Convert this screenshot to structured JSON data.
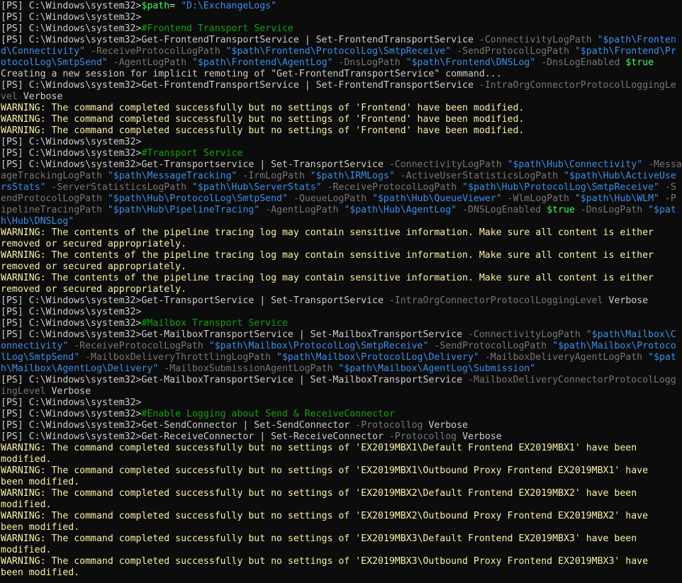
{
  "colors": {
    "background": "#0c0c0c",
    "plain": "#cccccc",
    "variable": "#3bff5e",
    "string": "#3b8eea",
    "comment": "#13a10e",
    "parameter": "#767676",
    "warning": "#f9f1a5"
  },
  "lines": [
    [
      [
        "plain",
        "[PS] C:\\Windows\\system32>"
      ],
      [
        "var",
        "$path"
      ],
      [
        "plain",
        "= "
      ],
      [
        "str",
        "\"D:\\ExchangeLogs\""
      ]
    ],
    [
      [
        "plain",
        "[PS] C:\\Windows\\system32>"
      ]
    ],
    [
      [
        "plain",
        "[PS] C:\\Windows\\system32>"
      ],
      [
        "comment",
        "#Frontend Transport Service"
      ]
    ],
    [
      [
        "plain",
        "[PS] C:\\Windows\\system32>Get-FrontendTransportService | Set-FrontendTransportService "
      ],
      [
        "param",
        "-ConnectivityLogPath "
      ],
      [
        "str",
        "\"$path\\Fronten"
      ]
    ],
    [
      [
        "str",
        "d\\Connectivity\" "
      ],
      [
        "param",
        "-ReceiveProtocolLogPath "
      ],
      [
        "str",
        "\"$path\\Frontend\\ProtocolLog\\SmtpReceive\" "
      ],
      [
        "param",
        "-SendProtocolLogPath "
      ],
      [
        "str",
        "\"$path\\Frontend\\Pr"
      ]
    ],
    [
      [
        "str",
        "otocolLog\\SmtpSend\" "
      ],
      [
        "param",
        "-AgentLogPath "
      ],
      [
        "str",
        "\"$path\\Frontend\\AgentLog\" "
      ],
      [
        "param",
        "-DnsLogPath "
      ],
      [
        "str",
        "\"$path\\Frontend\\DNSLog\" "
      ],
      [
        "param",
        "-DnsLogEnabled "
      ],
      [
        "var",
        "$true"
      ]
    ],
    [
      [
        "plain",
        "Creating a new session for implicit remoting of \"Get-FrontendTransportService\" command..."
      ]
    ],
    [
      [
        "plain",
        "[PS] C:\\Windows\\system32>Get-FrontendTransportService | Set-FrontendTransportService "
      ],
      [
        "param",
        "-IntraOrgConnectorProtocolLoggingLe"
      ]
    ],
    [
      [
        "param",
        "vel "
      ],
      [
        "plain",
        "Verbose"
      ]
    ],
    [
      [
        "warn",
        "WARNING: The command completed successfully but no settings of 'Frontend' have been modified."
      ]
    ],
    [
      [
        "warn",
        "WARNING: The command completed successfully but no settings of 'Frontend' have been modified."
      ]
    ],
    [
      [
        "warn",
        "WARNING: The command completed successfully but no settings of 'Frontend' have been modified."
      ]
    ],
    [
      [
        "plain",
        "[PS] C:\\Windows\\system32>"
      ]
    ],
    [
      [
        "plain",
        "[PS] C:\\Windows\\system32>"
      ],
      [
        "comment",
        "#Transport Service"
      ]
    ],
    [
      [
        "plain",
        "[PS] C:\\Windows\\system32>Get-Transportservice | Set-TransportService "
      ],
      [
        "param",
        "-ConnectivityLogPath "
      ],
      [
        "str",
        "\"$path\\Hub\\Connectivity\" "
      ],
      [
        "param",
        "-Messa"
      ]
    ],
    [
      [
        "param",
        "ageTrackingLogPath "
      ],
      [
        "str",
        "\"$path\\MessageTracking\" "
      ],
      [
        "param",
        "-IrmLogPath "
      ],
      [
        "str",
        "\"$path\\IRMLogs\" "
      ],
      [
        "param",
        "-ActiveUserStatisticsLogPath "
      ],
      [
        "str",
        "\"$path\\Hub\\ActiveUse"
      ]
    ],
    [
      [
        "str",
        "rsStats\" "
      ],
      [
        "param",
        "-ServerStatisticsLogPath "
      ],
      [
        "str",
        "\"$path\\Hub\\ServerStats\" "
      ],
      [
        "param",
        "-ReceiveProtocolLogPath "
      ],
      [
        "str",
        "\"$path\\Hub\\ProtocolLog\\SmtpReceive\" "
      ],
      [
        "param",
        "-S"
      ]
    ],
    [
      [
        "param",
        "endProtocolLogPath "
      ],
      [
        "str",
        "\"$path\\Hub\\ProtocolLog\\SmtpSend\" "
      ],
      [
        "param",
        "-QueueLogPath "
      ],
      [
        "str",
        "\"$path\\Hub\\QueueViewer\" "
      ],
      [
        "param",
        "-WlmLogPath "
      ],
      [
        "str",
        "\"$path\\Hub\\WLM\" "
      ],
      [
        "param",
        "-P"
      ]
    ],
    [
      [
        "param",
        "ipelineTracingPath "
      ],
      [
        "str",
        "\"$path\\Hub\\PipelineTracing\" "
      ],
      [
        "param",
        "-AgentLogPath "
      ],
      [
        "str",
        "\"$path\\Hub\\AgentLog\" "
      ],
      [
        "param",
        "-DNSLogEnabled "
      ],
      [
        "var",
        "$true "
      ],
      [
        "param",
        "-DnsLogPath "
      ],
      [
        "str",
        "\"$pat"
      ]
    ],
    [
      [
        "str",
        "h\\Hub\\DNSLog\""
      ]
    ],
    [
      [
        "warn",
        "WARNING: The contents of the pipeline tracing log may contain sensitive information. Make sure all content is either"
      ]
    ],
    [
      [
        "warn",
        "removed or secured appropriately."
      ]
    ],
    [
      [
        "warn",
        "WARNING: The contents of the pipeline tracing log may contain sensitive information. Make sure all content is either"
      ]
    ],
    [
      [
        "warn",
        "removed or secured appropriately."
      ]
    ],
    [
      [
        "warn",
        "WARNING: The contents of the pipeline tracing log may contain sensitive information. Make sure all content is either"
      ]
    ],
    [
      [
        "warn",
        "removed or secured appropriately."
      ]
    ],
    [
      [
        "plain",
        "[PS] C:\\Windows\\system32>Get-TransportService | Set-TransportService "
      ],
      [
        "param",
        "-IntraOrgConnectorProtocolLoggingLevel "
      ],
      [
        "plain",
        "Verbose"
      ]
    ],
    [
      [
        "plain",
        "[PS] C:\\Windows\\system32>"
      ]
    ],
    [
      [
        "plain",
        "[PS] C:\\Windows\\system32>"
      ],
      [
        "comment",
        "#Mailbox Transport Service"
      ]
    ],
    [
      [
        "plain",
        "[PS] C:\\Windows\\system32>Get-MailboxTransportService | Set-MailboxTransportService "
      ],
      [
        "param",
        "-ConnectivityLogPath "
      ],
      [
        "str",
        "\"$path\\Mailbox\\C"
      ]
    ],
    [
      [
        "str",
        "onnectivity\" "
      ],
      [
        "param",
        "-ReceiveProtocolLogPath "
      ],
      [
        "str",
        "\"$path\\Mailbox\\ProtocolLog\\SmtpReceive\" "
      ],
      [
        "param",
        "-SendProtocolLogPath "
      ],
      [
        "str",
        "\"$path\\Mailbox\\Protoco"
      ]
    ],
    [
      [
        "str",
        "lLog\\SmtpSend\" "
      ],
      [
        "param",
        "-MailboxDeliveryThrottlingLogPath "
      ],
      [
        "str",
        "\"$path\\Mailbox\\ProtocolLog\\Delivery\" "
      ],
      [
        "param",
        "-MailboxDeliveryAgentLogPath "
      ],
      [
        "str",
        "\"$pat"
      ]
    ],
    [
      [
        "str",
        "h\\Mailbox\\AgentLog\\Delivery\" "
      ],
      [
        "param",
        "-MailboxSubmissionAgentLogPath "
      ],
      [
        "str",
        "\"$path\\Mailbox\\AgentLog\\Submission\""
      ]
    ],
    [
      [
        "plain",
        "[PS] C:\\Windows\\system32>Get-MailboxTransportService | Set-MailboxTransportService "
      ],
      [
        "param",
        "-MailboxDeliveryConnectorProtocolLogg"
      ]
    ],
    [
      [
        "param",
        "ingLevel "
      ],
      [
        "plain",
        "Verbose"
      ]
    ],
    [
      [
        "plain",
        "[PS] C:\\Windows\\system32>"
      ]
    ],
    [
      [
        "plain",
        "[PS] C:\\Windows\\system32>"
      ],
      [
        "comment",
        "#Enable Logging about Send & ReceiveConnector"
      ]
    ],
    [
      [
        "plain",
        "[PS] C:\\Windows\\system32>Get-SendConnector | Set-SendConnector "
      ],
      [
        "param",
        "-Protocollog "
      ],
      [
        "plain",
        "Verbose"
      ]
    ],
    [
      [
        "plain",
        "[PS] C:\\Windows\\system32>Get-ReceiveConnector | Set-ReceiveConnector "
      ],
      [
        "param",
        "-Protocollog "
      ],
      [
        "plain",
        "Verbose"
      ]
    ],
    [
      [
        "warn",
        "WARNING: The command completed successfully but no settings of 'EX2019MBX1\\Default Frontend EX2019MBX1' have been"
      ]
    ],
    [
      [
        "warn",
        "modified."
      ]
    ],
    [
      [
        "warn",
        "WARNING: The command completed successfully but no settings of 'EX2019MBX1\\Outbound Proxy Frontend EX2019MBX1' have"
      ]
    ],
    [
      [
        "warn",
        "been modified."
      ]
    ],
    [
      [
        "warn",
        "WARNING: The command completed successfully but no settings of 'EX2019MBX2\\Default Frontend EX2019MBX2' have been"
      ]
    ],
    [
      [
        "warn",
        "modified."
      ]
    ],
    [
      [
        "warn",
        "WARNING: The command completed successfully but no settings of 'EX2019MBX2\\Outbound Proxy Frontend EX2019MBX2' have"
      ]
    ],
    [
      [
        "warn",
        "been modified."
      ]
    ],
    [
      [
        "warn",
        "WARNING: The command completed successfully but no settings of 'EX2019MBX3\\Default Frontend EX2019MBX3' have been"
      ]
    ],
    [
      [
        "warn",
        "modified."
      ]
    ],
    [
      [
        "warn",
        "WARNING: The command completed successfully but no settings of 'EX2019MBX3\\Outbound Proxy Frontend EX2019MBX3' have"
      ]
    ],
    [
      [
        "warn",
        "been modified."
      ]
    ]
  ]
}
